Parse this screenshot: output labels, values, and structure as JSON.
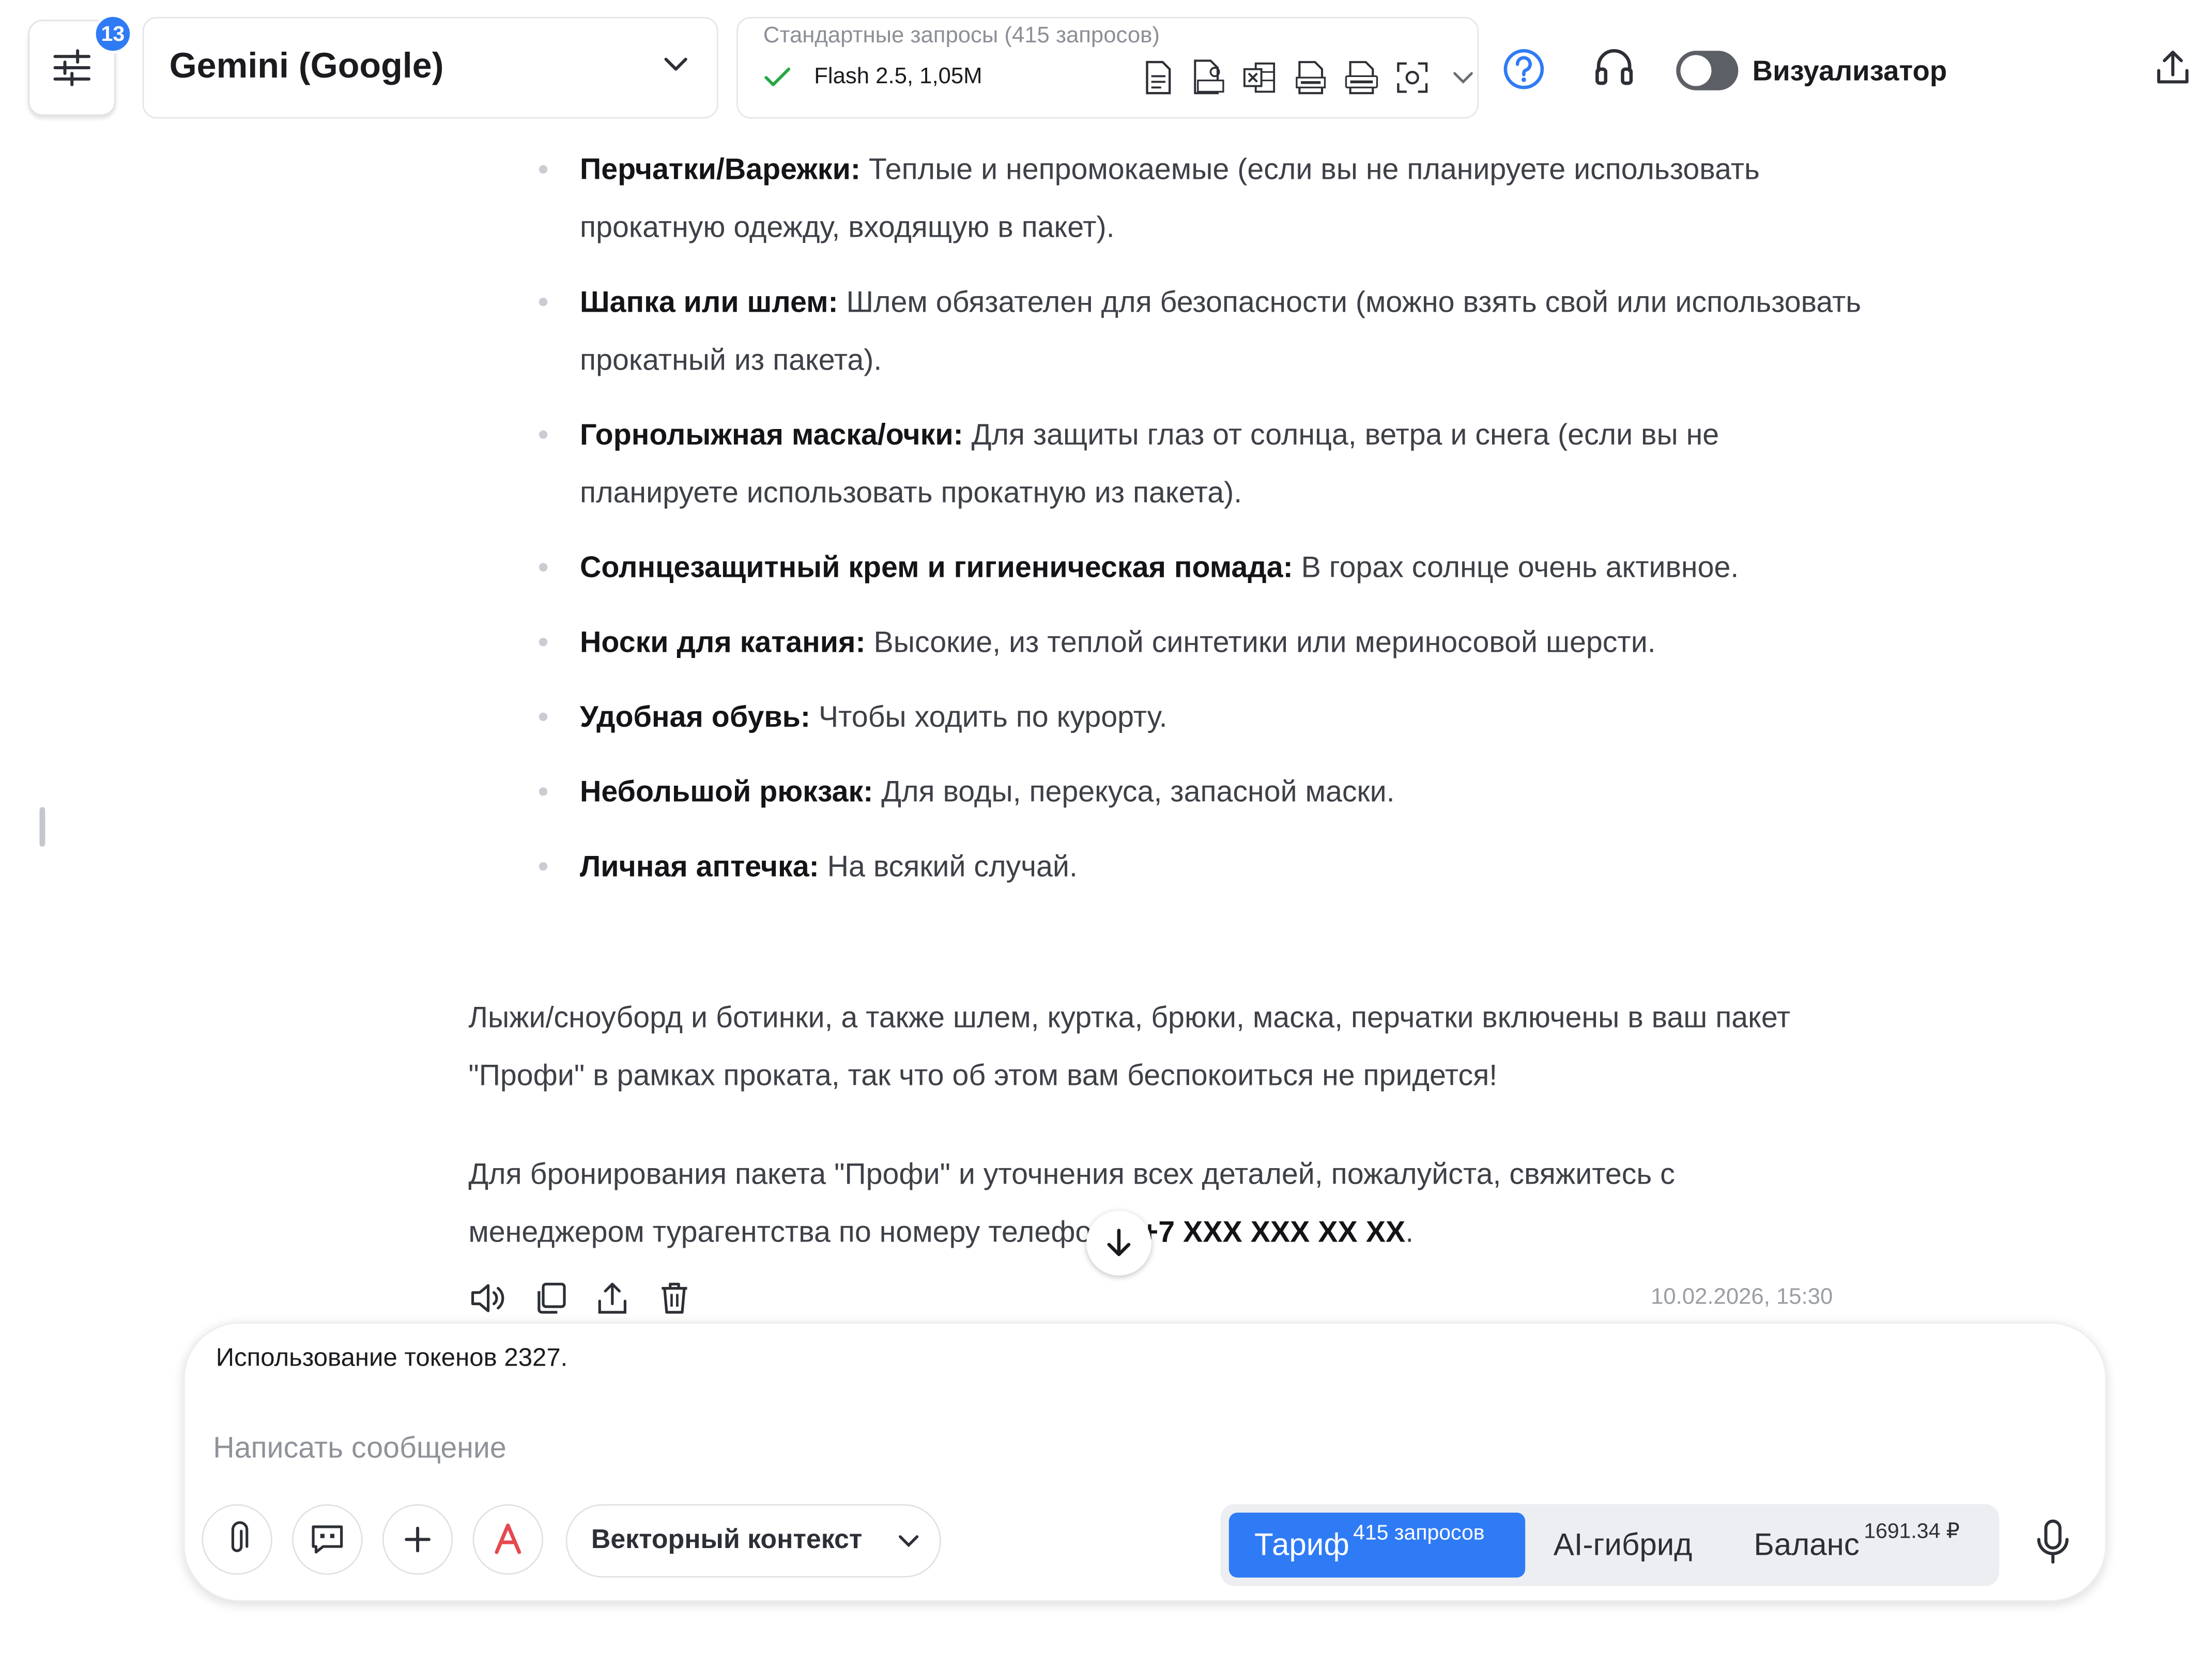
{
  "header": {
    "settings_badge": "13",
    "model_name": "Gemini (Google)",
    "requests_title": "Стандартные запросы (415 запросов)",
    "requests_model": "Flash 2.5, 1,05M",
    "visualizer_label": "Визуализатор",
    "visualizer_on": false
  },
  "content": {
    "bullets": [
      {
        "term": "Перчатки/Варежки:",
        "text": " Теплые и непромокаемые (если вы не планируете использовать прокатную одежду, входящую в пакет)."
      },
      {
        "term": "Шапка или шлем:",
        "text": " Шлем обязателен для безопасности (можно взять свой или использовать прокатный из пакета)."
      },
      {
        "term": "Горнолыжная маска/очки:",
        "text": " Для защиты глаз от солнца, ветра и снега (если вы не планируете использовать прокатную из пакета)."
      },
      {
        "term": "Солнцезащитный крем и гигиеническая помада:",
        "text": " В горах солнце очень активное."
      },
      {
        "term": "Носки для катания:",
        "text": " Высокие, из теплой синтетики или мериносовой шерсти."
      },
      {
        "term": "Удобная обувь:",
        "text": " Чтобы ходить по курорту."
      },
      {
        "term": "Небольшой рюкзак:",
        "text": " Для воды, перекуса, запасной маски."
      },
      {
        "term": "Личная аптечка:",
        "text": " На всякий случай."
      }
    ],
    "para1": "Лыжи/сноуборд и ботинки, а также шлем, куртка, брюки, маска, перчатки включены в ваш пакет \"Профи\" в рамках проката, так что об этом вам беспокоиться не придется!",
    "para2_text": "Для бронирования пакета \"Профи\" и уточнения всех деталей, пожалуйста, свяжитесь с менеджером турагентства по номеру телефона: ",
    "para2_phone": "+7 XXX XXX XX XX",
    "para2_end": ".",
    "timestamp": "10.02.2026, 15:30"
  },
  "composer": {
    "tokens_usage": "Использование токенов 2327.",
    "placeholder": "Написать сообщение",
    "value": "",
    "vector_context_label": "Векторный контекст",
    "tariff_label": "Тариф",
    "tariff_sup": "415 запросов",
    "ai_hybrid_label": "AI-гибрид",
    "balance_label": "Баланс",
    "balance_sup": "1691.34 ₽"
  },
  "colors": {
    "accent": "#2f7bf5",
    "check_green": "#27a844",
    "text_muted": "#8c8f96"
  },
  "icons": [
    "sliders-icon",
    "chevron-down-icon",
    "check-icon",
    "doc-icon",
    "pdf-icon",
    "excel-icon",
    "txt-icon",
    "docx-icon",
    "scan-icon",
    "help-icon",
    "headset-icon",
    "share-icon",
    "arrow-down-icon",
    "speaker-icon",
    "copy-icon",
    "trash-icon",
    "paperclip-icon",
    "prompt-icon",
    "plus-icon",
    "spellcheck-icon",
    "microphone-icon"
  ]
}
